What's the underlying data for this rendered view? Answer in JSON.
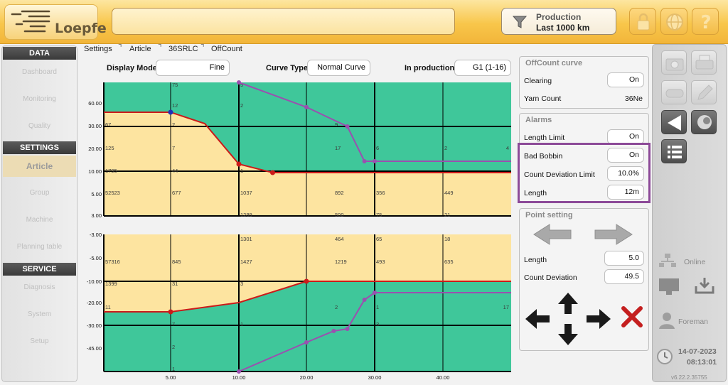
{
  "header": {
    "logo_text": "Loepfe",
    "production_label": "Production",
    "production_value": "Last 1000 km"
  },
  "nav": {
    "sections": [
      {
        "title": "DATA",
        "items": [
          "Dashboard",
          "Monitoring",
          "Quality"
        ]
      },
      {
        "title": "SETTINGS",
        "items": [
          "Article",
          "Group",
          "Machine",
          "Planning table"
        ]
      },
      {
        "title": "SERVICE",
        "items": [
          "Diagnosis",
          "System",
          "Setup"
        ]
      }
    ],
    "active": "Article"
  },
  "breadcrumb": [
    "Settings",
    "Article",
    "36SRLC",
    "OffCount"
  ],
  "controls": {
    "display_mode_label": "Display Mode",
    "display_mode_value": "Fine",
    "curve_type_label": "Curve Type",
    "curve_type_value": "Normal Curve",
    "in_production_label": "In production",
    "in_production_value": "G1 (1-16)"
  },
  "chart_data": [
    {
      "type": "line",
      "y_ticks": [
        "60.00",
        "30.00",
        "20.00",
        "10.00",
        "5.00",
        "3.00"
      ],
      "clearing_curve": [
        [
          0,
          55.5
        ],
        [
          5,
          55.5
        ],
        [
          7.5,
          40
        ],
        [
          10,
          12
        ],
        [
          15,
          9.5
        ],
        [
          20,
          9.5
        ],
        [
          30,
          9.5
        ],
        [
          40,
          9.5
        ],
        [
          47,
          9.5
        ]
      ],
      "class_curve": [
        [
          10,
          90
        ],
        [
          20,
          58
        ],
        [
          26,
          30
        ],
        [
          28.5,
          12.5
        ],
        [
          30,
          12.5
        ],
        [
          47,
          12.5
        ]
      ],
      "cell_labels": {
        "row60": [
          "",
          "75",
          "5",
          "",
          "",
          "",
          ""
        ],
        "row55": [
          "",
          "12",
          "2",
          "",
          "",
          "",
          ""
        ],
        "row30": [
          "67",
          "2",
          "",
          "9",
          "",
          "",
          ""
        ],
        "row20": [
          "125",
          "7",
          "",
          "17",
          "6",
          "2",
          "4"
        ],
        "row10": [
          "1795",
          "44",
          "1",
          "",
          "",
          "",
          ""
        ],
        "row5": [
          "52523",
          "677",
          "1037",
          "892",
          "356",
          "449",
          ""
        ],
        "row3": [
          "",
          "",
          "1289",
          "500",
          "75",
          "21",
          ""
        ]
      }
    },
    {
      "type": "line",
      "y_ticks": [
        "-3.00",
        "-5.00",
        "-10.00",
        "-20.00",
        "-30.00",
        "-45.00"
      ],
      "x_ticks": [
        "5.00",
        "10.00",
        "20.00",
        "30.00",
        "40.00"
      ],
      "clearing_curve": [
        [
          0,
          -21.5
        ],
        [
          5,
          -21.5
        ],
        [
          10,
          -19
        ],
        [
          20,
          -10
        ],
        [
          30,
          -10
        ],
        [
          47,
          -10
        ]
      ],
      "class_curve": [
        [
          10,
          -55
        ],
        [
          20,
          -40
        ],
        [
          24,
          -32
        ],
        [
          26,
          -30
        ],
        [
          28.5,
          -17
        ],
        [
          30,
          -13
        ],
        [
          47,
          -13
        ]
      ],
      "cell_labels": {
        "rowA": [
          "",
          "",
          "1301",
          "464",
          "65",
          "18",
          ""
        ],
        "rowB": [
          "57316",
          "845",
          "1427",
          "1219",
          "493",
          "635",
          ""
        ],
        "rowC": [
          "1399",
          "31",
          "3",
          "",
          "",
          "",
          ""
        ],
        "rowD": [
          "11",
          "",
          "",
          "2",
          "1",
          "",
          "17"
        ],
        "rowE": [
          "",
          "7",
          "1",
          "",
          "3",
          "",
          ""
        ],
        "rowF": [
          "",
          "2",
          "",
          "",
          "",
          "",
          ""
        ],
        "rowG": [
          "",
          "1",
          "",
          "",
          "",
          "",
          ""
        ]
      }
    }
  ],
  "offcount_panel": {
    "title": "OffCount curve",
    "clearing_label": "Clearing",
    "clearing_value": "On",
    "yarn_count_label": "Yarn Count",
    "yarn_count_value": "36Ne"
  },
  "alarms_panel": {
    "title": "Alarms",
    "length_limit_label": "Length Limit",
    "length_limit_value": "On",
    "bad_bobbin_label": "Bad Bobbin",
    "bad_bobbin_value": "On",
    "count_dev_label": "Count Deviation Limit",
    "count_dev_value": "10.0%",
    "length_label": "Length",
    "length_value": "12m"
  },
  "point_panel": {
    "title": "Point setting",
    "length_label": "Length",
    "length_value": "5.0",
    "count_dev_label": "Count Deviation",
    "count_dev_value": "49.5"
  },
  "right_toolbar": {
    "online_label": "Online",
    "user_label": "Foreman",
    "date": "14-07-2023",
    "time": "08:13:01",
    "version": "v6.22.2.35755"
  },
  "colors": {
    "green_zone": "#3fc79a",
    "yellow_zone": "#fde4a0",
    "clearing_line": "#cc1a1a",
    "class_line": "#9b4fb0",
    "highlight": "#8c4a98"
  }
}
